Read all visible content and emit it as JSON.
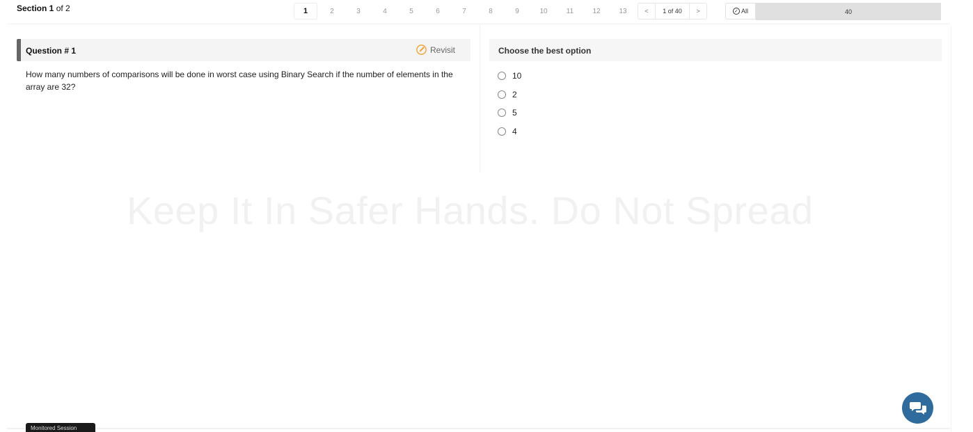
{
  "section": {
    "label": "Section 1",
    "of": "of 2"
  },
  "question_nav": {
    "numbers": [
      "1",
      "2",
      "3",
      "4",
      "5",
      "6",
      "7",
      "8",
      "9",
      "10",
      "11",
      "12",
      "13"
    ],
    "active": "1",
    "prev": "<",
    "next": ">",
    "page_info": "1 of 40"
  },
  "filter": {
    "label": "All",
    "icon": "check-circle-icon"
  },
  "total": "40",
  "question": {
    "title": "Question # 1",
    "revisit_label": "Revisit",
    "revisit_icon": "edit-pencil-icon",
    "text": "How many numbers of comparisons will be done in worst case using Binary Search if the number of elements in the array are 32?"
  },
  "options_panel": {
    "title": "Choose the best option",
    "options": [
      "10",
      "2",
      "5",
      "4"
    ]
  },
  "watermark": "Keep It In Safer Hands. Do Not Spread",
  "monitored_label": "Monitored Session",
  "chat_icon": "chat-bubble-icon",
  "colors": {
    "accent_bar": "#666666",
    "chat_button": "#2f6b9c",
    "revisit_icon": "#f0a43a"
  }
}
